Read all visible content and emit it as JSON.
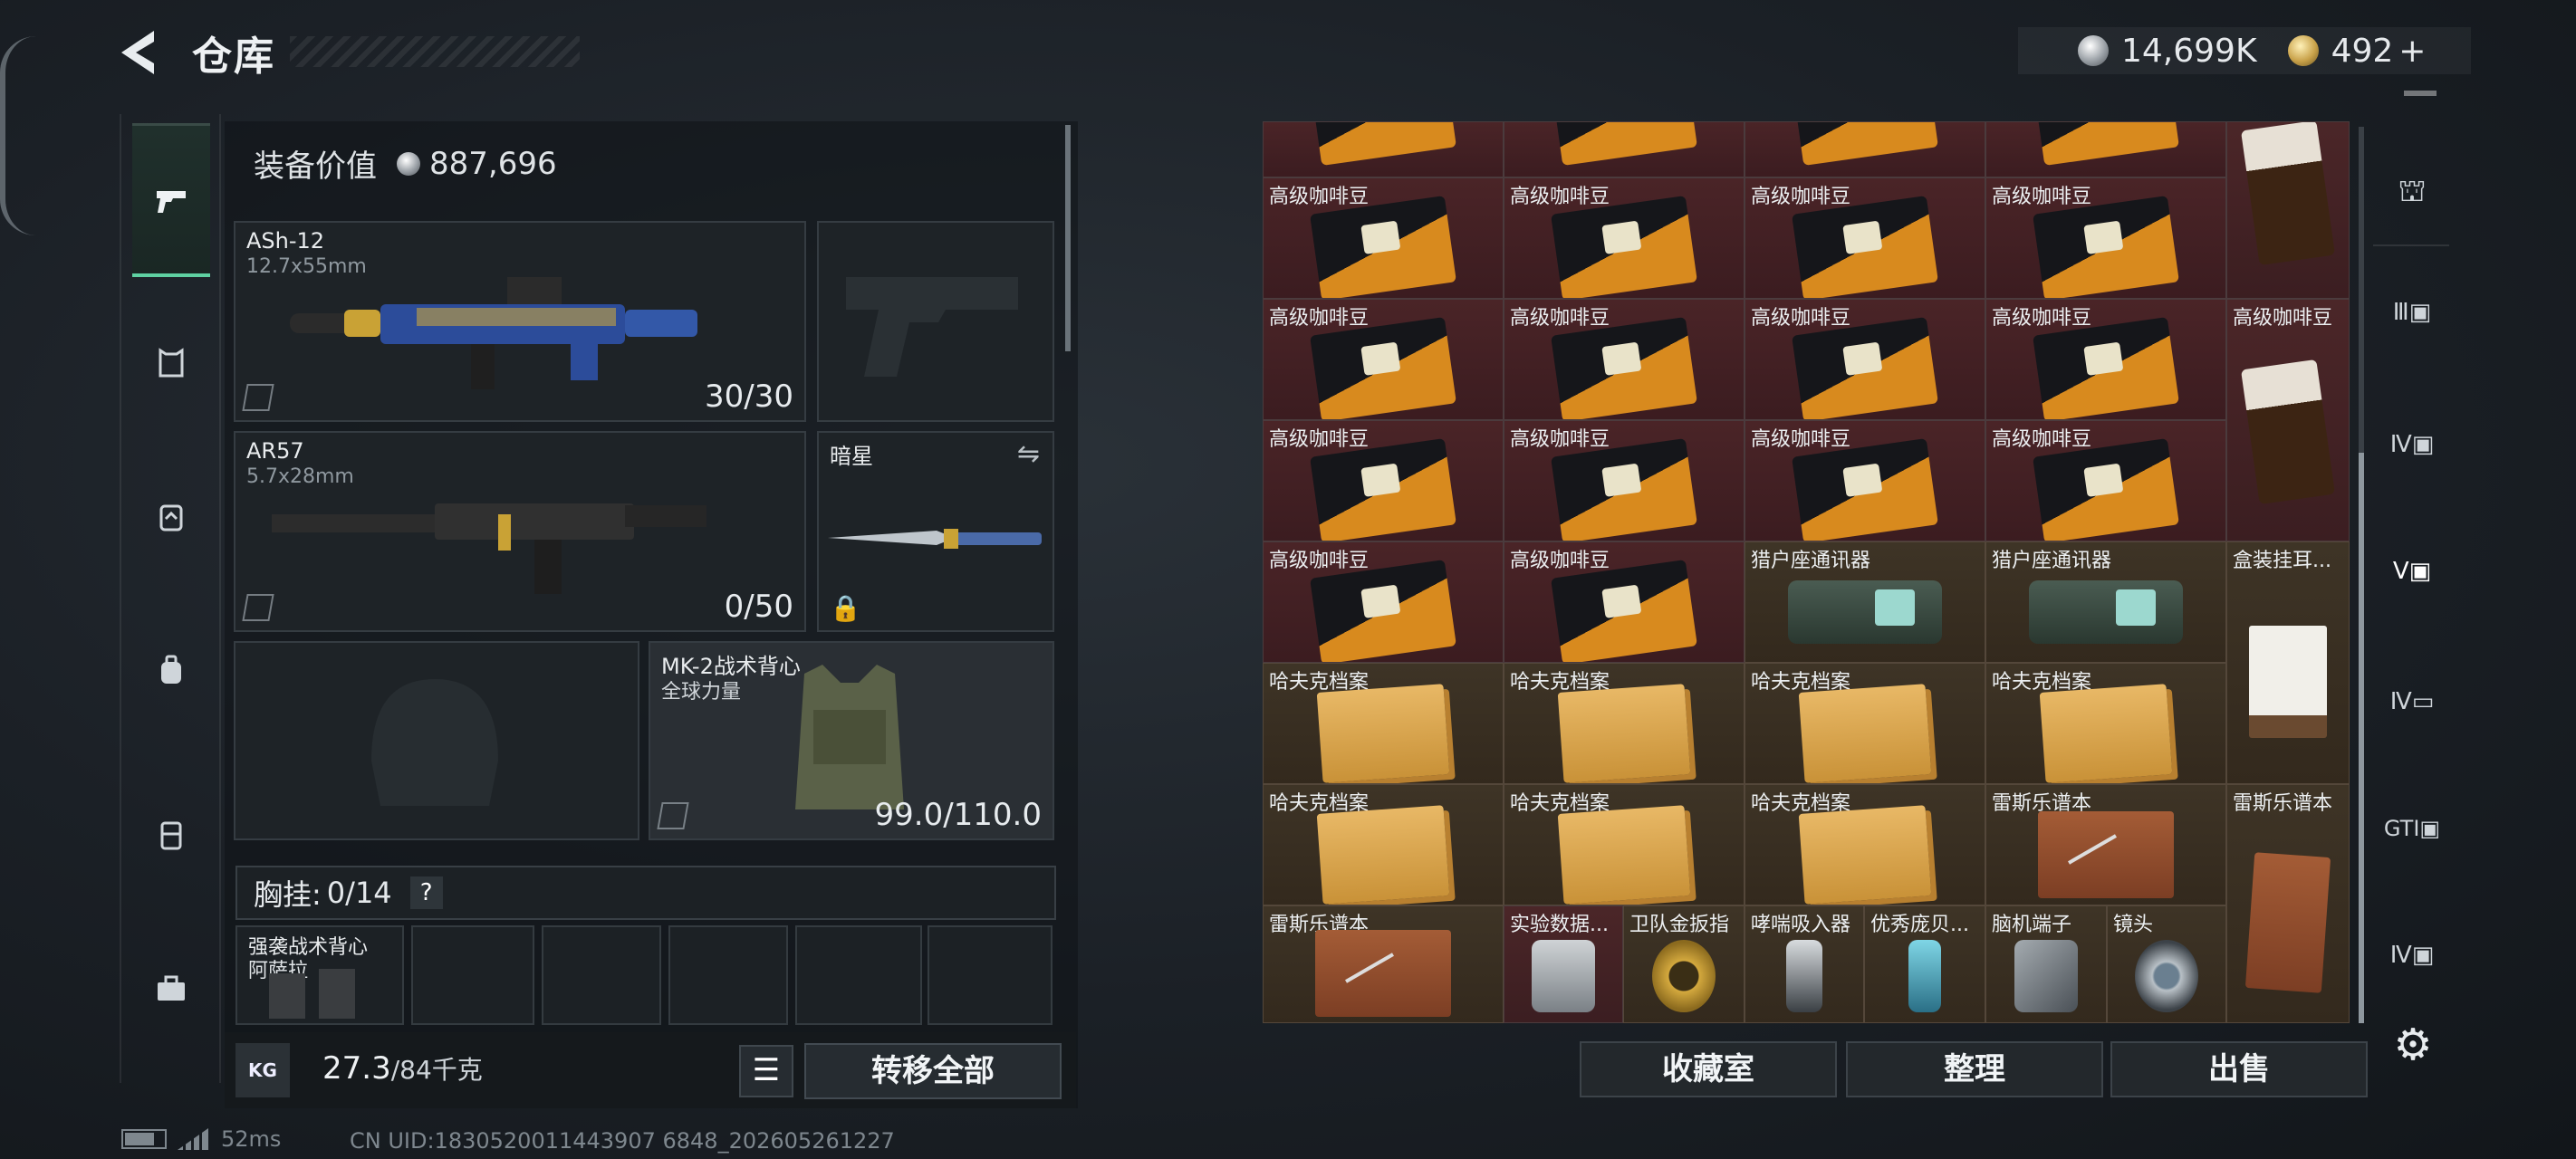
{
  "header": {
    "title": "仓库",
    "currency": {
      "silver": "14,699K",
      "gold": "492",
      "gold_add": "+"
    }
  },
  "left_rail": {
    "items": [
      {
        "icon": "pistol-icon",
        "active": true
      },
      {
        "icon": "armor-icon"
      },
      {
        "icon": "backpack-icon"
      },
      {
        "icon": "bag-icon"
      },
      {
        "icon": "case-icon"
      },
      {
        "icon": "toolbox-icon"
      }
    ]
  },
  "loadout": {
    "equip_value_label": "装备价值",
    "equip_value": "887,696",
    "primary": {
      "name": "ASh-12",
      "caliber": "12.7x55mm",
      "ammo": "30/30"
    },
    "secondary": {
      "name": "AR57",
      "caliber": "5.7x28mm",
      "ammo": "0/50"
    },
    "melee": {
      "name": "暗星"
    },
    "vest": {
      "name": "MK-2战术背心",
      "sub": "全球力量",
      "durability": "99.0/110.0"
    },
    "chest": {
      "label": "胸挂:",
      "count": "0/14",
      "help": "?"
    },
    "pouch_first": {
      "name": "强袭战术背心",
      "sub": "阿萨拉"
    },
    "weight": {
      "value": "27.3",
      "max": "/84千克"
    },
    "kg_label": "KG",
    "transfer_all": "转移全部"
  },
  "storage": {
    "labels": {
      "coffee": "高级咖啡豆",
      "comm": "猎户座通讯器",
      "box": "盒装挂耳...",
      "hafuk": "哈夫克档案",
      "leis": "雷斯乐谱本",
      "data": "实验数据...",
      "ring": "卫队金扳指",
      "inhaler": "哮喘吸入器",
      "excellent": "优秀庞贝...",
      "brain": "脑机端子",
      "lens": "镜头"
    }
  },
  "right_rail": {
    "items": [
      "helmet-icon",
      "tier3-icon",
      "tier4-icon",
      "tier5-icon",
      "tier4b-icon",
      "gti-icon",
      "tier4c-icon"
    ]
  },
  "footer": {
    "collection": "收藏室",
    "organize": "整理",
    "sell": "出售"
  },
  "status": {
    "ping": "52ms",
    "uid": "CN UID:1830520011443907 6848_202605261227"
  }
}
